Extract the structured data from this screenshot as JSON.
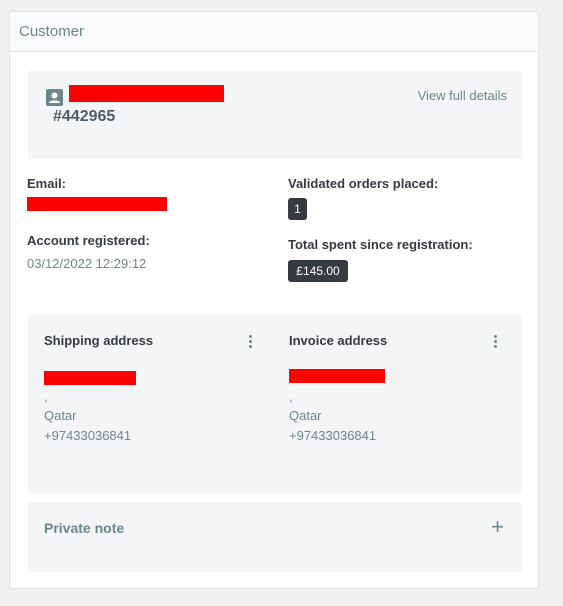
{
  "panel": {
    "title": "Customer"
  },
  "customer": {
    "id": "#442965",
    "view_link": "View full details"
  },
  "info": {
    "email_label": "Email:",
    "registered_label": "Account registered:",
    "registered_value": "03/12/2022 12:29:12",
    "orders_label": "Validated orders placed:",
    "orders_value": "1",
    "spent_label": "Total spent since registration:",
    "spent_value": "£145.00"
  },
  "shipping": {
    "title": "Shipping address",
    "comma": ",",
    "country": "Qatar",
    "phone": "+97433036841"
  },
  "invoice": {
    "title": "Invoice address",
    "comma": ",",
    "country": "Qatar",
    "phone": "+97433036841"
  },
  "note": {
    "title": "Private note",
    "toggle": "+"
  },
  "colors": {
    "accent_text": "#6c868e",
    "badge_bg": "#363a41",
    "redaction": "#ff0000"
  },
  "icons": {
    "customer": "person-card-icon",
    "address_menu": "kebab-menu-icon",
    "note_toggle": "plus-icon"
  }
}
